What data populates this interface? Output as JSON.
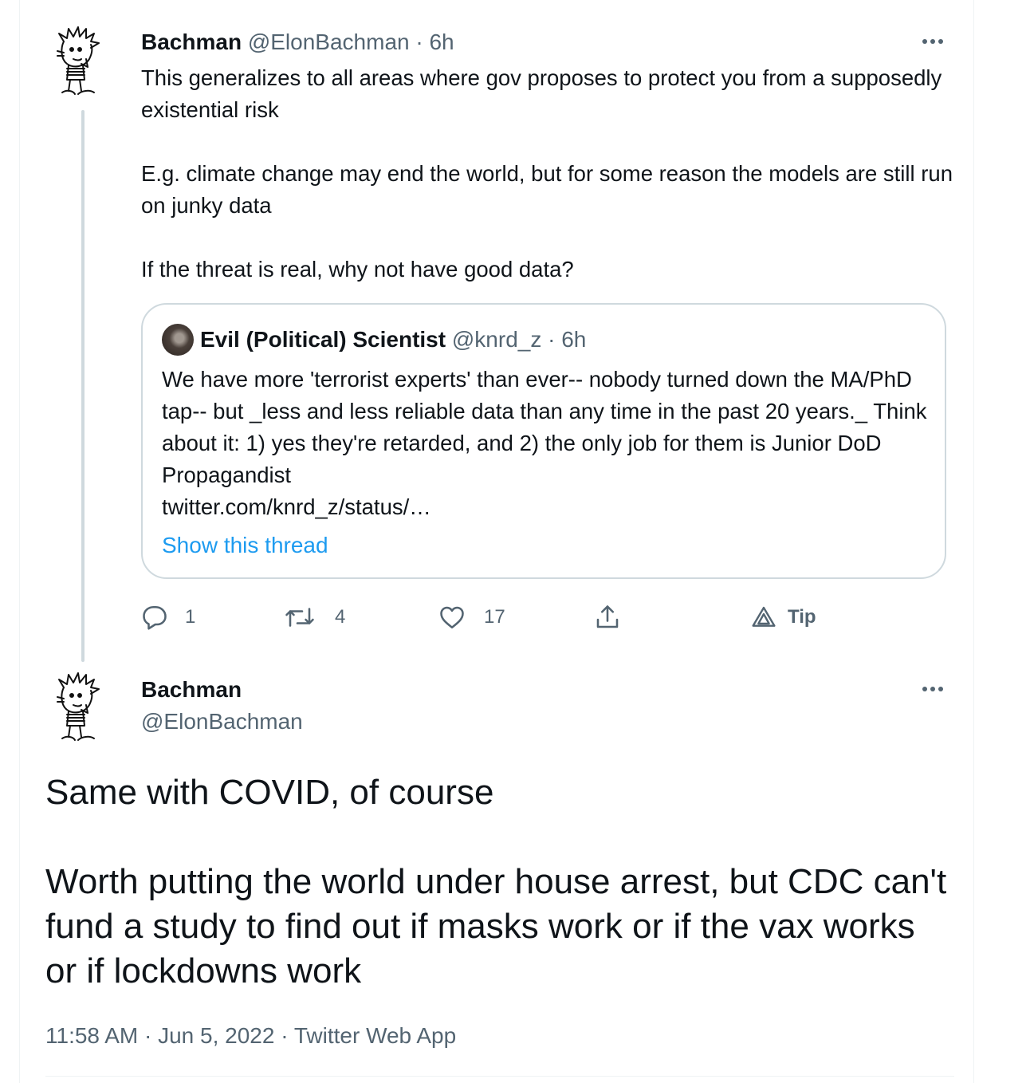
{
  "tweet1": {
    "name": "Bachman",
    "handle": "@ElonBachman",
    "sep": "·",
    "time": "6h",
    "paragraphs": [
      "This generalizes to all areas where gov proposes to protect you from a supposedly existential risk",
      "E.g. climate change may end the world, but for some reason the models are still run on junky data",
      "If the threat is real, why not have good data?"
    ],
    "quote": {
      "name": "Evil (Political) Scientist",
      "handle": "@knrd_z",
      "sep": "·",
      "time": "6h",
      "text": "We have more 'terrorist experts' than ever-- nobody turned down the MA/PhD tap-- but _less and less reliable data than any time in the past 20 years._ Think about it: 1) yes they're retarded, and 2) the only job for them is Junior DoD Propagandist",
      "link": "twitter.com/knrd_z/status/…",
      "show_thread": "Show this thread"
    },
    "actions": {
      "reply_count": "1",
      "retweet_count": "4",
      "like_count": "17",
      "tip_label": "Tip"
    }
  },
  "tweet2": {
    "name": "Bachman",
    "handle": "@ElonBachman",
    "paragraphs": [
      "Same with COVID, of course",
      "Worth putting the world under house arrest, but CDC can't fund a study to find out if masks work or if the vax works or if lockdowns work"
    ],
    "meta": "11:58 AM · Jun 5, 2022 · Twitter Web App"
  },
  "icons": {
    "reply": "reply-icon",
    "retweet": "retweet-icon",
    "like": "heart-icon",
    "share": "share-icon",
    "tip": "tip-icon",
    "more": "more-icon"
  },
  "colors": {
    "text": "#0f1419",
    "secondary": "#536471",
    "link": "#1d9bf0",
    "border": "#cfd9de"
  }
}
